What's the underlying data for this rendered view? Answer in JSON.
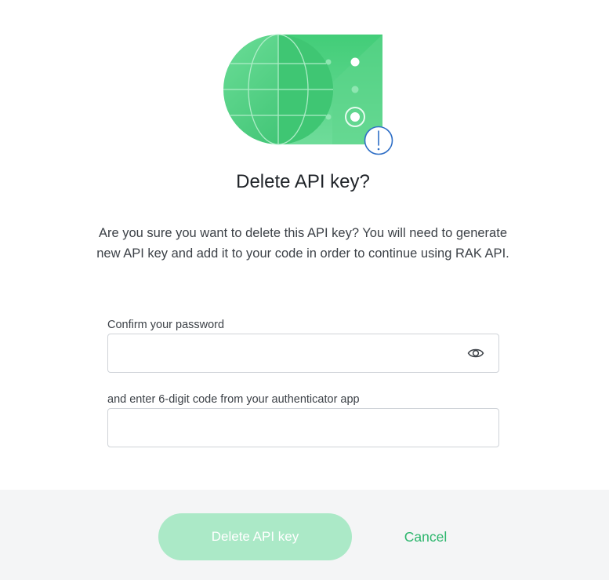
{
  "dialog": {
    "title": "Delete API key?",
    "message": "Are you sure you want to delete this API key? You will need to generate new API key and add it to your code in order to continue using RAK API.",
    "password_field": {
      "label": "Confirm your password",
      "value": "",
      "placeholder": ""
    },
    "code_field": {
      "label": "and enter 6-digit code from your authenticator app",
      "value": "",
      "placeholder": ""
    },
    "actions": {
      "delete_label": "Delete API key",
      "cancel_label": "Cancel"
    }
  },
  "icons": {
    "illustration": "globe-api-card-illustration",
    "warning_badge": "exclamation-icon",
    "password_toggle": "eye-icon"
  },
  "colors": {
    "accent": "#2db66d",
    "delete_button_disabled": "#abe9c7",
    "illustration_green": "#3cc774",
    "warning_border": "#2f6fc6",
    "footer_background": "#f4f5f6"
  }
}
